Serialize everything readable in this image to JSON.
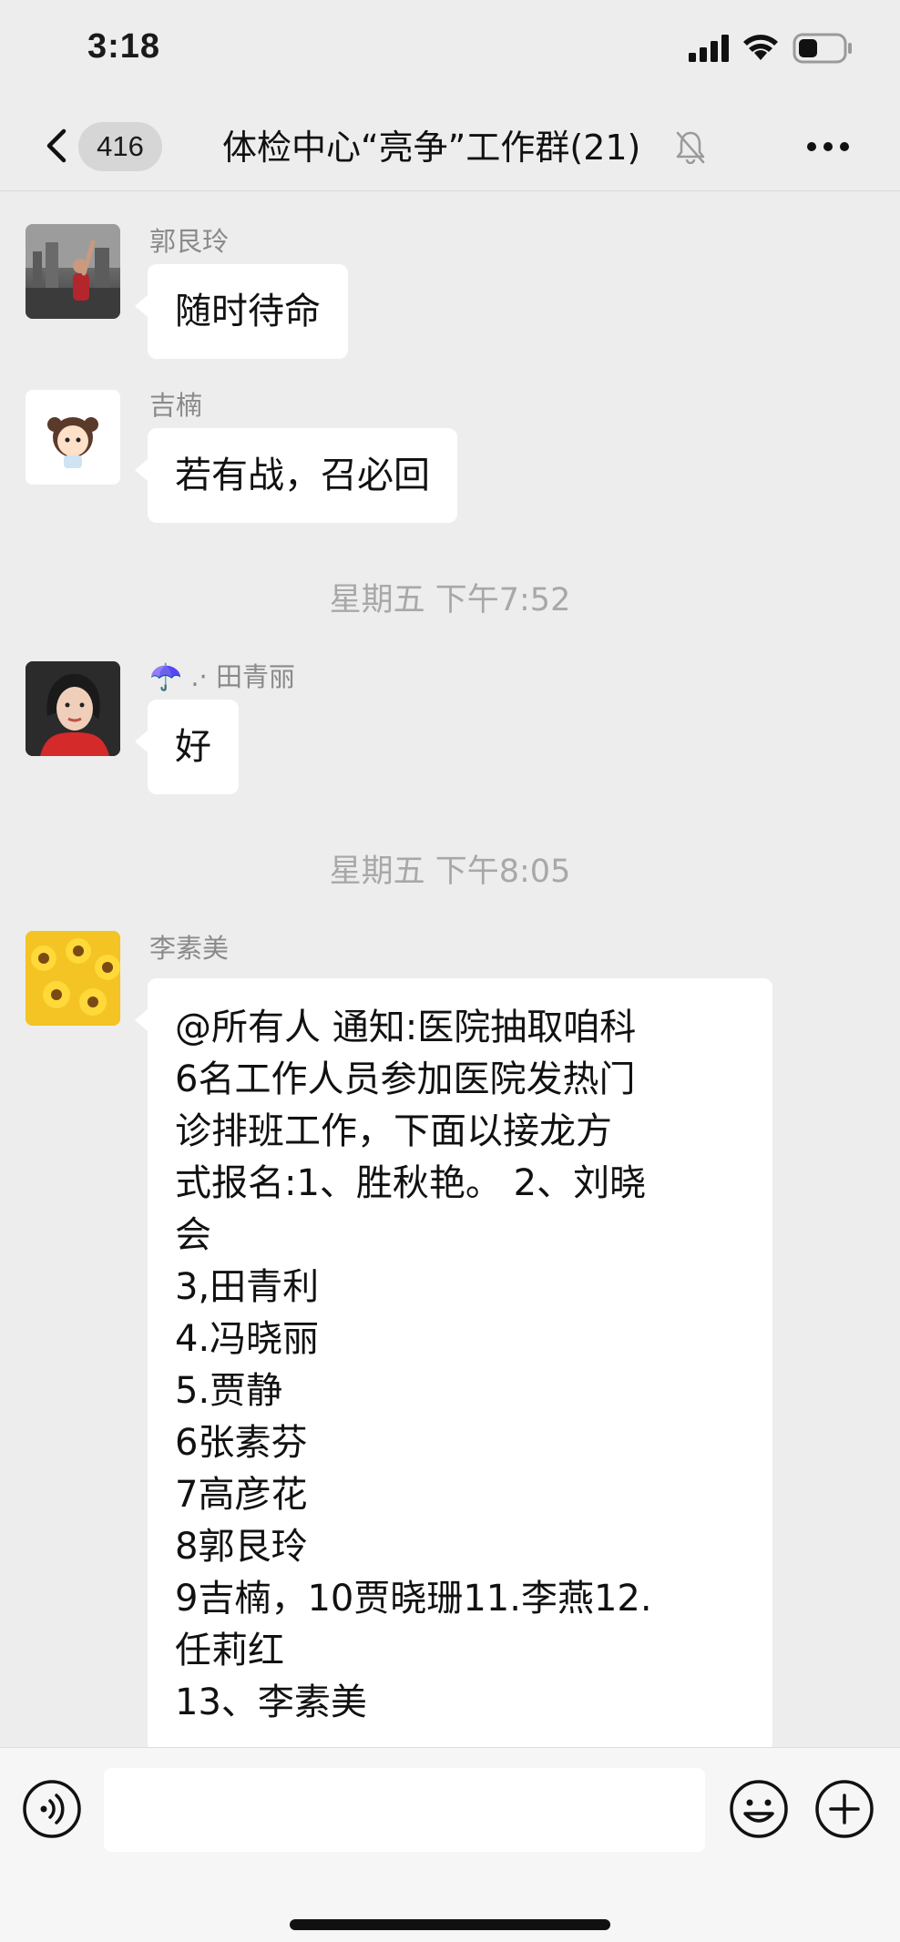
{
  "status_bar": {
    "time": "3:18"
  },
  "nav": {
    "back_count": "416",
    "title": "体检中心“亮争”工作群(21)"
  },
  "messages": [
    {
      "sender": "郭艮玲",
      "text": "随时待命"
    },
    {
      "sender": "吉楠",
      "text": "若有战，召必回"
    },
    {
      "timestamp": "星期五 下午7:52"
    },
    {
      "sender": "☂️ .· 田青丽",
      "text": "好"
    },
    {
      "timestamp": "星期五 下午8:05"
    },
    {
      "sender": "李素美",
      "lines": [
        "@所有人  通知:医院抽取咱科",
        "6名工作人员参加医院发热门",
        "诊排班工作，下面以接龙方",
        "式报名:1、胜秋艳。  2、刘晓",
        "会",
        "3,田青利",
        "4.冯晓丽",
        "5.贾静",
        "6张素芬",
        "7高彦花",
        "8郭艮玲",
        "9吉楠，10贾晓珊11.李燕12.",
        "任莉红",
        "13、李素美"
      ]
    }
  ]
}
